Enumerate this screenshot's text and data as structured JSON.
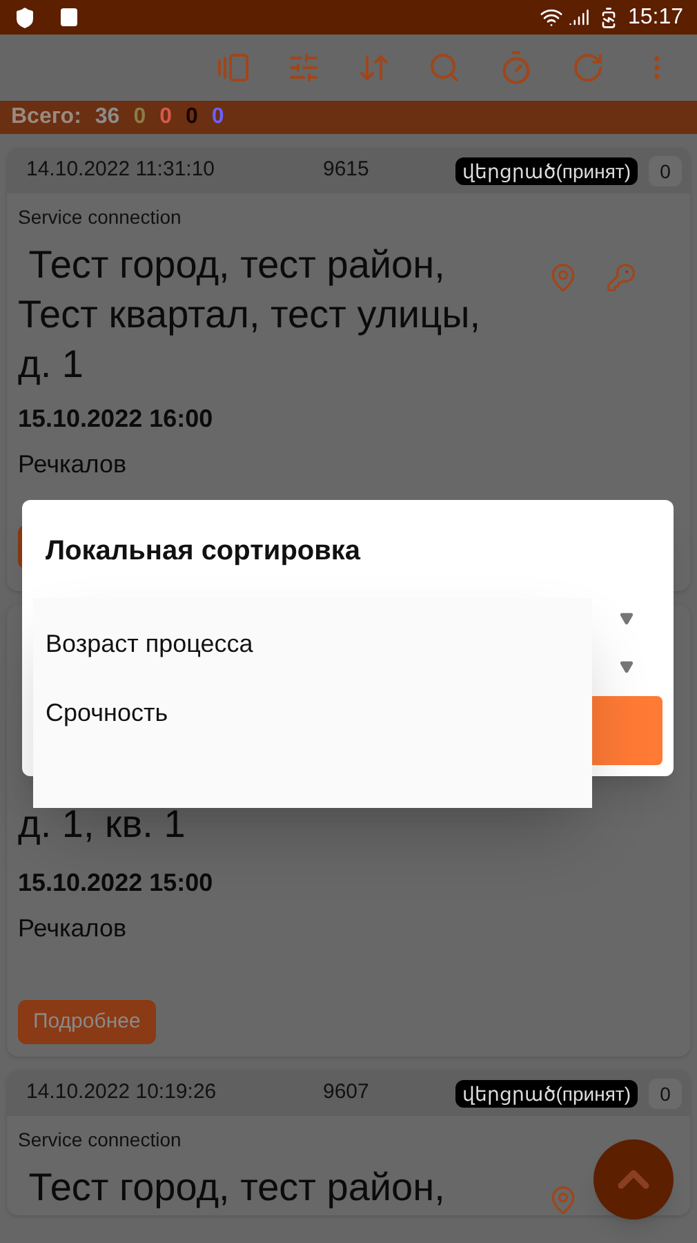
{
  "status_bar": {
    "time": "15:17"
  },
  "summary": {
    "label": "Всего:",
    "counts": [
      {
        "value": "36",
        "color": "#8c8c8c"
      },
      {
        "value": "0",
        "color": "#8a7d45"
      },
      {
        "value": "0",
        "color": "#d8584a"
      },
      {
        "value": "0",
        "color": "#1a0500"
      },
      {
        "value": "0",
        "color": "#6a60ff"
      }
    ]
  },
  "cards": [
    {
      "kind": "full",
      "timestamp": "14.10.2022 11:31:10",
      "number": "9615",
      "status": "վերցրած(принят)",
      "count": "0",
      "type": "Service connection",
      "address": " Тест город, тест район, Тест квартал, тест улицы, д. 1",
      "due": "15.10.2022 16:00",
      "assignee": "Речкалов",
      "has_key": true
    },
    {
      "kind": "covered",
      "address": "д. 1, кв. 1",
      "due": "15.10.2022 15:00",
      "assignee": "Речкалов",
      "button": "Подробнее"
    },
    {
      "kind": "full",
      "timestamp": "14.10.2022 10:19:26",
      "number": "9607",
      "status": "վերցրած(принят)",
      "count": "0",
      "type": "Service connection",
      "address": " Тест город, тест район,",
      "has_key": false
    }
  ],
  "dialog": {
    "title": "Локальная сортировка",
    "menu": [
      {
        "label": "Возраст процесса"
      },
      {
        "label": "Срочность"
      }
    ]
  }
}
